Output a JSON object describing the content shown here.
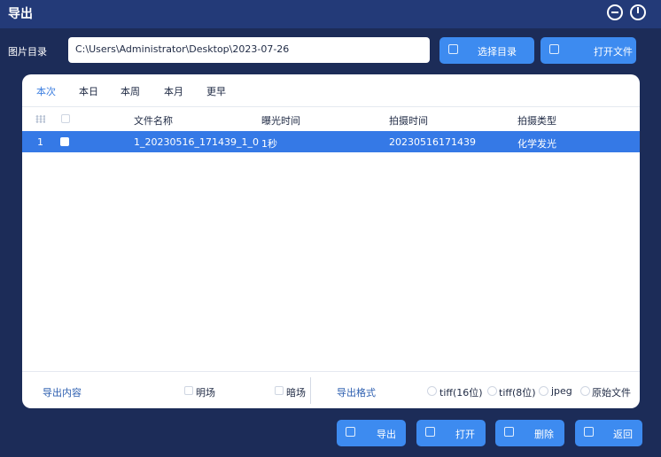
{
  "window": {
    "title": "导出"
  },
  "path": {
    "label": "图片目录",
    "value": "C:\\Users\\Administrator\\Desktop\\2023-07-26"
  },
  "toolbar": {
    "select_dir": "选择目录",
    "open_file": "打开文件"
  },
  "tabs": [
    {
      "label": "本次",
      "active": true
    },
    {
      "label": "本日"
    },
    {
      "label": "本周"
    },
    {
      "label": "本月"
    },
    {
      "label": "更早"
    }
  ],
  "table": {
    "headers": {
      "filename": "文件名称",
      "exposure": "曝光时间",
      "captured": "拍摄时间",
      "type": "拍摄类型"
    },
    "rows": [
      {
        "index": "1",
        "checked": true,
        "filename": "1_20230516_171439_1_0",
        "exposure": "1秒",
        "captured": "20230516171439",
        "type": "化学发光"
      }
    ]
  },
  "export": {
    "content_label": "导出内容",
    "bright": "明场",
    "dark": "暗场",
    "format_label": "导出格式",
    "formats": [
      "tiff(16位)",
      "tiff(8位)",
      "jpeg",
      "原始文件"
    ]
  },
  "actions": {
    "export": "导出",
    "open": "打开",
    "delete": "删除",
    "back": "返回"
  },
  "colors": {
    "accent": "#3d8bf0",
    "selected_row": "#3579e6",
    "background": "#1c2c58",
    "titlebar": "#233a78"
  }
}
